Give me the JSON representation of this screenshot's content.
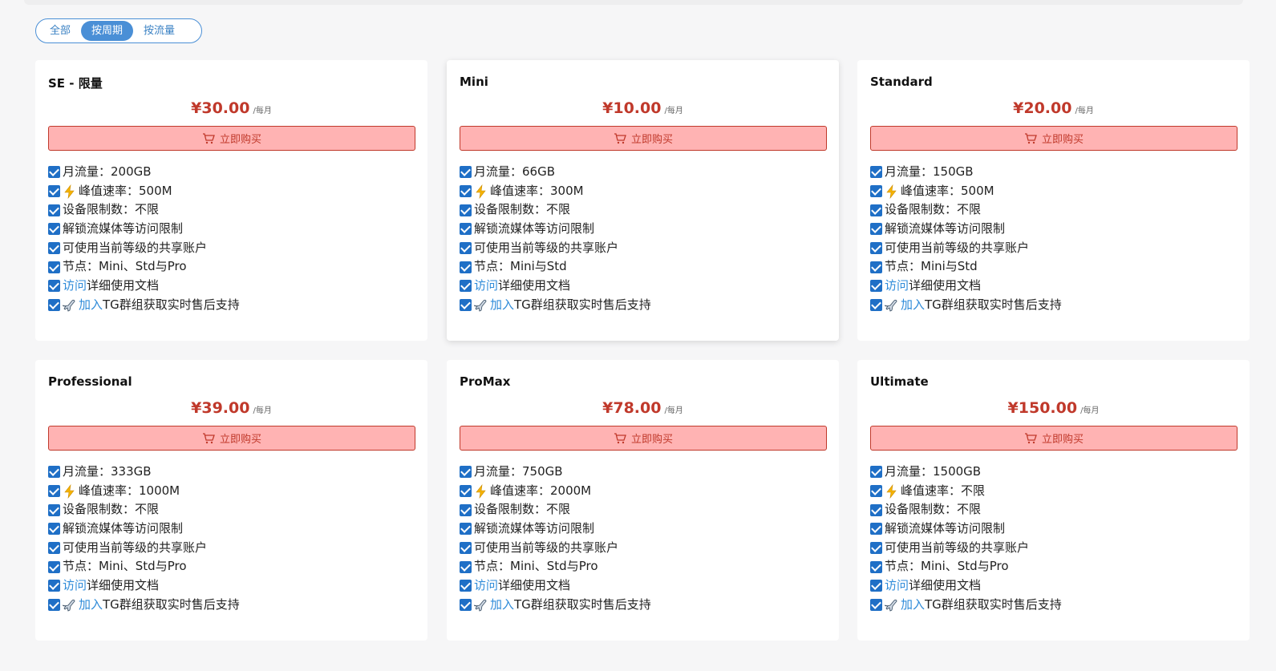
{
  "filters": {
    "tabs": [
      "全部",
      "按周期",
      "按流量"
    ],
    "active": 1
  },
  "buy_label": "立即购买",
  "currency": "¥",
  "period_label": "/每月",
  "colors": {
    "price": "#c0392b",
    "accent": "#4a8fd6",
    "link": "#2f8bd9",
    "check": "#1f6fc6"
  },
  "plans": [
    {
      "name": "SE - 限量",
      "price": "¥30.00",
      "features": {
        "traffic": "月流量：200GB",
        "speed": "峰值速率：500M",
        "devices": "设备限制数：不限",
        "unlock": "解锁流媒体等访问限制",
        "shared": "可使用当前等级的共享账户",
        "nodes": "节点：Mini、Std与Pro",
        "docs_link": "访问",
        "docs_text": "详细使用文档",
        "tg_link": "加入",
        "tg_text": "TG群组获取实时售后支持"
      }
    },
    {
      "name": "Mini",
      "price": "¥10.00",
      "features": {
        "traffic": "月流量：66GB",
        "speed": "峰值速率：300M",
        "devices": "设备限制数：不限",
        "unlock": "解锁流媒体等访问限制",
        "shared": "可使用当前等级的共享账户",
        "nodes": "节点：Mini与Std",
        "docs_link": "访问",
        "docs_text": "详细使用文档",
        "tg_link": "加入",
        "tg_text": "TG群组获取实时售后支持"
      }
    },
    {
      "name": "Standard",
      "price": "¥20.00",
      "features": {
        "traffic": "月流量：150GB",
        "speed": "峰值速率：500M",
        "devices": "设备限制数：不限",
        "unlock": "解锁流媒体等访问限制",
        "shared": "可使用当前等级的共享账户",
        "nodes": "节点：Mini与Std",
        "docs_link": "访问",
        "docs_text": "详细使用文档",
        "tg_link": "加入",
        "tg_text": "TG群组获取实时售后支持"
      }
    },
    {
      "name": "Professional",
      "price": "¥39.00",
      "features": {
        "traffic": "月流量：333GB",
        "speed": "峰值速率：1000M",
        "devices": "设备限制数：不限",
        "unlock": "解锁流媒体等访问限制",
        "shared": "可使用当前等级的共享账户",
        "nodes": "节点：Mini、Std与Pro",
        "docs_link": "访问",
        "docs_text": "详细使用文档",
        "tg_link": "加入",
        "tg_text": "TG群组获取实时售后支持"
      }
    },
    {
      "name": "ProMax",
      "price": "¥78.00",
      "features": {
        "traffic": "月流量：750GB",
        "speed": "峰值速率：2000M",
        "devices": "设备限制数：不限",
        "unlock": "解锁流媒体等访问限制",
        "shared": "可使用当前等级的共享账户",
        "nodes": "节点：Mini、Std与Pro",
        "docs_link": "访问",
        "docs_text": "详细使用文档",
        "tg_link": "加入",
        "tg_text": "TG群组获取实时售后支持"
      }
    },
    {
      "name": "Ultimate",
      "price": "¥150.00",
      "features": {
        "traffic": "月流量：1500GB",
        "speed": "峰值速率：不限",
        "devices": "设备限制数：不限",
        "unlock": "解锁流媒体等访问限制",
        "shared": "可使用当前等级的共享账户",
        "nodes": "节点：Mini、Std与Pro",
        "docs_link": "访问",
        "docs_text": "详细使用文档",
        "tg_link": "加入",
        "tg_text": "TG群组获取实时售后支持"
      }
    }
  ]
}
